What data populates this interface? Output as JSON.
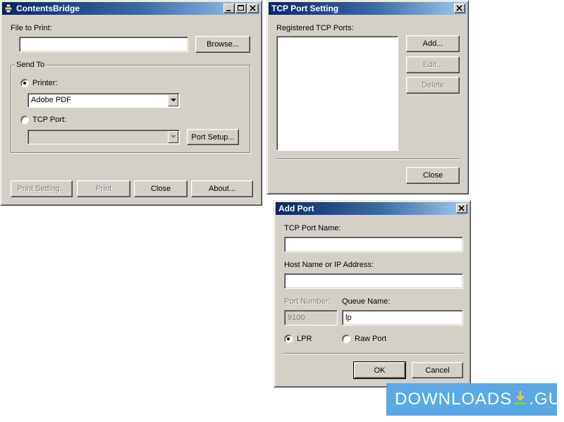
{
  "contents_bridge": {
    "title": "ContentsBridge",
    "file_to_print_label": "File to Print:",
    "file_value": "",
    "browse_label": "Browse...",
    "send_to_label": "Send To",
    "printer_label": "Printer:",
    "printer_value": "Adobe PDF",
    "tcp_port_label": "TCP Port:",
    "tcp_port_value": "",
    "port_setup_label": "Port Setup...",
    "print_setting_label": "Print Setting...",
    "print_label": "Print",
    "close_label": "Close",
    "about_label": "About..."
  },
  "tcp_port_setting": {
    "title": "TCP Port Setting",
    "registered_label": "Registered TCP Ports:",
    "ports": [],
    "add_label": "Add...",
    "edit_label": "Edit...",
    "delete_label": "Delete",
    "close_label": "Close"
  },
  "add_port": {
    "title": "Add Port",
    "port_name_label": "TCP Port Name:",
    "port_name_value": "",
    "host_label": "Host Name or IP Address:",
    "host_value": "",
    "port_number_label": "Port Number:",
    "port_number_value": "9100",
    "queue_name_label": "Queue Name:",
    "queue_name_value": "lp",
    "lpr_label": "LPR",
    "raw_port_label": "Raw Port",
    "ok_label": "OK",
    "cancel_label": "Cancel"
  },
  "watermark": {
    "text_left": "DOWNLOADS",
    "text_right": ".GURU",
    "icon": "download-icon",
    "color": "#5aa8e6"
  },
  "window_controls": {
    "minimize": "minimize-icon",
    "maximize": "maximize-icon",
    "close": "close-icon"
  }
}
